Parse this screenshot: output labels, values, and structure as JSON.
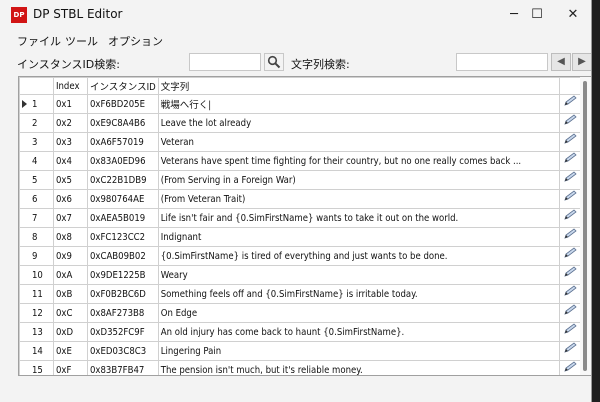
{
  "window": {
    "title": "DP STBL Editor",
    "icon_text": "DP",
    "controls": {
      "minimize": "─",
      "maximize": "☐",
      "close": "✕"
    }
  },
  "menu": [
    "ファイル",
    "ツール",
    "オプション"
  ],
  "search": {
    "instance_label": "インスタンスID検索:",
    "instance_value": "",
    "text_label": "文字列検索:",
    "text_value": ""
  },
  "table": {
    "columns": [
      "",
      "Index",
      "インスタンスID",
      "文字列",
      ""
    ],
    "rows": [
      {
        "num": "1",
        "index": "0x1",
        "id": "0xF6BD205E",
        "text": "戦場へ行く|"
      },
      {
        "num": "2",
        "index": "0x2",
        "id": "0xE9C8A4B6",
        "text": "Leave the lot already"
      },
      {
        "num": "3",
        "index": "0x3",
        "id": "0xA6F57019",
        "text": "Veteran"
      },
      {
        "num": "4",
        "index": "0x4",
        "id": "0x83A0ED96",
        "text": "Veterans have spent time fighting for their country, but no one really comes back ..."
      },
      {
        "num": "5",
        "index": "0x5",
        "id": "0xC22B1DB9",
        "text": "(From Serving in a Foreign War)"
      },
      {
        "num": "6",
        "index": "0x6",
        "id": "0x980764AE",
        "text": "(From Veteran Trait)"
      },
      {
        "num": "7",
        "index": "0x7",
        "id": "0xAEA5B019",
        "text": "Life isn't fair and {0.SimFirstName} wants to take it out on the world."
      },
      {
        "num": "8",
        "index": "0x8",
        "id": "0xFC123CC2",
        "text": "Indignant"
      },
      {
        "num": "9",
        "index": "0x9",
        "id": "0xCAB09B02",
        "text": "{0.SimFirstName} is tired of everything and just wants to be done."
      },
      {
        "num": "10",
        "index": "0xA",
        "id": "0x9DE1225B",
        "text": "Weary"
      },
      {
        "num": "11",
        "index": "0xB",
        "id": "0xF0B2BC6D",
        "text": "Something feels off and {0.SimFirstName} is irritable today."
      },
      {
        "num": "12",
        "index": "0xC",
        "id": "0x8AF273B8",
        "text": "On Edge"
      },
      {
        "num": "13",
        "index": "0xD",
        "id": "0xD352FC9F",
        "text": "An old injury has come back to haunt {0.SimFirstName}."
      },
      {
        "num": "14",
        "index": "0xE",
        "id": "0xED03C8C3",
        "text": "Lingering Pain"
      },
      {
        "num": "15",
        "index": "0xF",
        "id": "0x83B7FB47",
        "text": "The pension isn't much, but it's reliable money."
      }
    ],
    "selected_row": 0
  },
  "icons": {
    "search": "magnifier-icon",
    "edit": "pencil-icon",
    "prev": "triangle-left-icon",
    "next": "triangle-right-icon"
  }
}
